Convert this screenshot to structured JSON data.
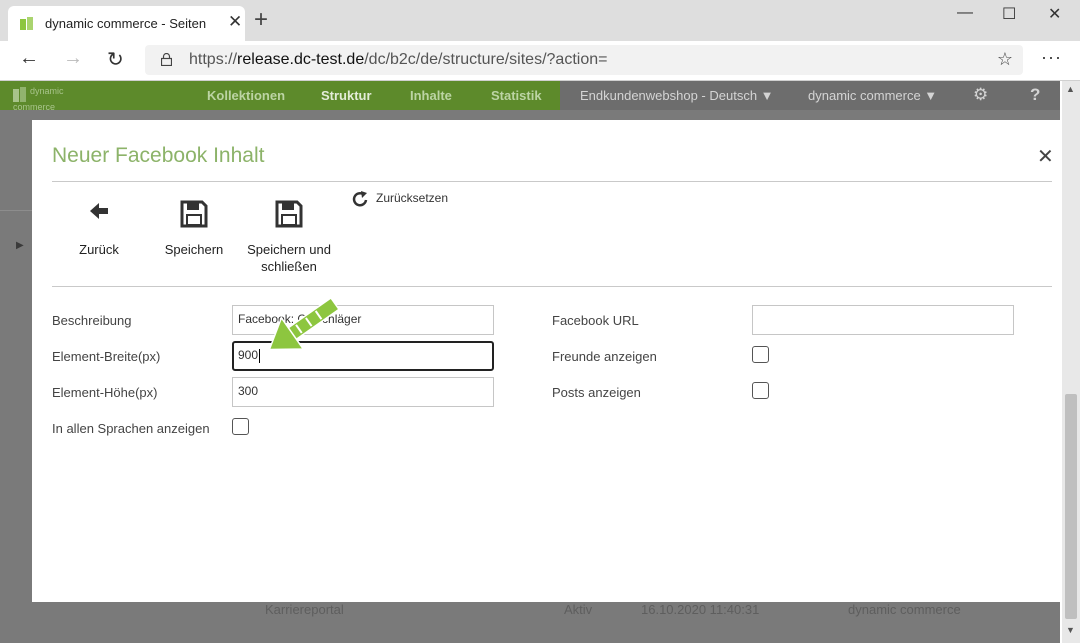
{
  "browser": {
    "tab_title": "dynamic commerce - Seiten",
    "tab_close": "✕",
    "new_tab": "+",
    "window_minimize": "—",
    "window_maximize": "☐",
    "window_close": "✕",
    "url_prefix": "https://",
    "url_host": "release.dc-test.de",
    "url_path": "/dc/b2c/de/structure/sites/?action=",
    "back_icon": "←",
    "forward_icon": "→",
    "refresh_icon": "↻",
    "favorite_icon": "☆",
    "menu_icon": "···"
  },
  "app": {
    "logo_line1": "dynamic",
    "logo_line2": "commerce",
    "nav": [
      "Kollektionen",
      "Struktur",
      "Inhalte",
      "Statistik"
    ],
    "shop_dropdown": "Endkundenwebshop - Deutsch ▼",
    "user_dropdown": "dynamic commerce ▼",
    "help_icon": "?",
    "background_row": {
      "name": "Karriereportal",
      "status": "Aktiv",
      "date": "16.10.2020 11:40:31",
      "owner": "dynamic commerce"
    }
  },
  "modal": {
    "title": "Neuer Facebook Inhalt",
    "close": "✕",
    "toolbar": {
      "back_label": "Zurück",
      "save_label": "Speichern",
      "save_close_label_1": "Speichern und",
      "save_close_label_2": "schließen",
      "reset_label": "Zurücksetzen"
    },
    "form": {
      "description_label": "Beschreibung",
      "description_value": "Facebook: Ostschläger",
      "width_label": "Element-Breite(px)",
      "width_value": "900",
      "height_label": "Element-Höhe(px)",
      "height_value": "300",
      "all_languages_label": "In allen Sprachen anzeigen",
      "all_languages_checked": false,
      "facebook_url_label": "Facebook URL",
      "facebook_url_value": "",
      "show_friends_label": "Freunde anzeigen",
      "show_friends_checked": false,
      "show_posts_label": "Posts anzeigen",
      "show_posts_checked": false
    }
  },
  "colors": {
    "brand_green": "#5d8a2b",
    "title_green": "#8cb369",
    "arrow_green": "#8dc63f"
  }
}
